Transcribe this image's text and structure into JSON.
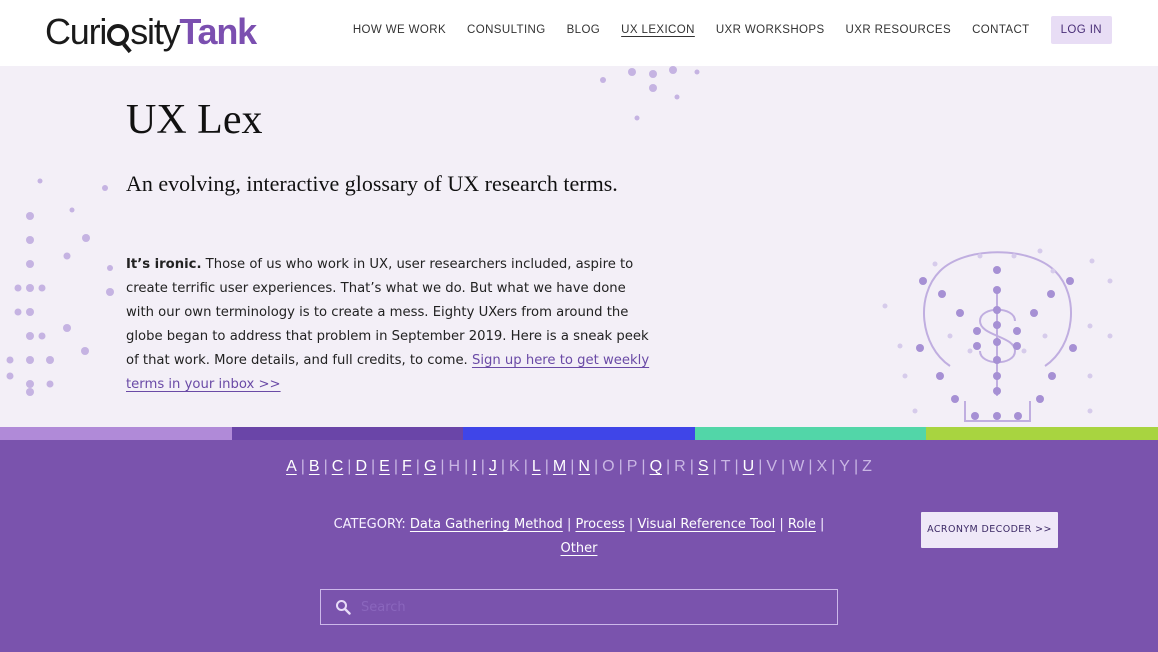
{
  "header": {
    "logo": {
      "part1": "Curi",
      "part2": "sity",
      "part3": "Tank"
    },
    "nav": [
      {
        "label": "HOW WE WORK"
      },
      {
        "label": "CONSULTING"
      },
      {
        "label": "BLOG"
      },
      {
        "label": "UX LEXICON",
        "active": true
      },
      {
        "label": "UXR WORKSHOPS"
      },
      {
        "label": "UXR RESOURCES"
      },
      {
        "label": "CONTACT"
      }
    ],
    "login_label": "LOG IN"
  },
  "hero": {
    "title": "UX Lex",
    "subtitle": "An evolving, interactive glossary of UX research terms.",
    "intro_bold": "It’s ironic.",
    "intro_text": " Those of us who work in UX, user researchers included, aspire to create terrific user experiences. That’s what we do. But what we have done with our own terminology is to create a mess. Eighty UXers from around the globe began to address that problem in September 2019. Here is a sneak peek of that work. More details, and full credits, to come. ",
    "signup_link": "Sign up here to get weekly terms in your inbox >>"
  },
  "band_colors": [
    "#b08ad8",
    "#6a45a8",
    "#3f45e8",
    "#52d6a8",
    "#a8d440"
  ],
  "alphabet": [
    {
      "letter": "A",
      "active": true
    },
    {
      "letter": "B",
      "active": true
    },
    {
      "letter": "C",
      "active": true
    },
    {
      "letter": "D",
      "active": true
    },
    {
      "letter": "E",
      "active": true
    },
    {
      "letter": "F",
      "active": true
    },
    {
      "letter": "G",
      "active": true
    },
    {
      "letter": "H",
      "active": false
    },
    {
      "letter": "I",
      "active": true
    },
    {
      "letter": "J",
      "active": true
    },
    {
      "letter": "K",
      "active": false
    },
    {
      "letter": "L",
      "active": true
    },
    {
      "letter": "M",
      "active": true
    },
    {
      "letter": "N",
      "active": true
    },
    {
      "letter": "O",
      "active": false
    },
    {
      "letter": "P",
      "active": false
    },
    {
      "letter": "Q",
      "active": true
    },
    {
      "letter": "R",
      "active": false
    },
    {
      "letter": "S",
      "active": true
    },
    {
      "letter": "T",
      "active": false
    },
    {
      "letter": "U",
      "active": true
    },
    {
      "letter": "V",
      "active": false
    },
    {
      "letter": "W",
      "active": false
    },
    {
      "letter": "X",
      "active": false
    },
    {
      "letter": "Y",
      "active": false
    },
    {
      "letter": "Z",
      "active": false
    }
  ],
  "category": {
    "label": "CATEGORY:",
    "items": [
      "Data Gathering Method",
      "Process",
      "Visual Reference Tool",
      "Role",
      "Other"
    ]
  },
  "acronym_button": "ACRONYM DECODER >>",
  "search": {
    "placeholder": "Search",
    "icon": "search-icon"
  },
  "colors": {
    "accent": "#7a53ad",
    "hero_bg": "#f3eff7",
    "login_bg": "#e8ddf5"
  }
}
